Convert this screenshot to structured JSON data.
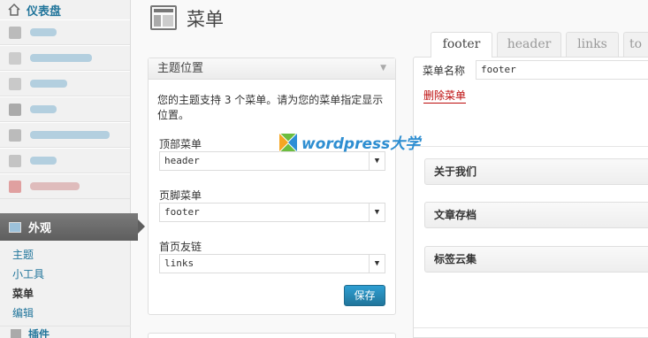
{
  "sidebar": {
    "dashboard": "仪表盘",
    "appearance": "外观",
    "sub_items": [
      "主题",
      "小工具",
      "菜单",
      "编辑"
    ],
    "plugins_partial": "插件"
  },
  "header": {
    "title": "菜单"
  },
  "tabs": [
    "footer",
    "header",
    "links",
    "to"
  ],
  "locations": {
    "title": "主题位置",
    "description": "您的主题支持 3 个菜单。请为您的菜单指定显示位置。",
    "fields": [
      {
        "label": "顶部菜单",
        "value": "header"
      },
      {
        "label": "页脚菜单",
        "value": "footer"
      },
      {
        "label": "首页友链",
        "value": "links"
      }
    ],
    "save_label": "保存"
  },
  "editor": {
    "name_label": "菜单名称",
    "name_value": "footer",
    "delete_label": "删除菜单",
    "items": [
      "关于我们",
      "文章存档",
      "标签云集"
    ]
  },
  "watermark": "wordpress大学",
  "colors": {
    "link": "#21759b",
    "delete": "#bc0b0b",
    "button": "#21759b"
  }
}
